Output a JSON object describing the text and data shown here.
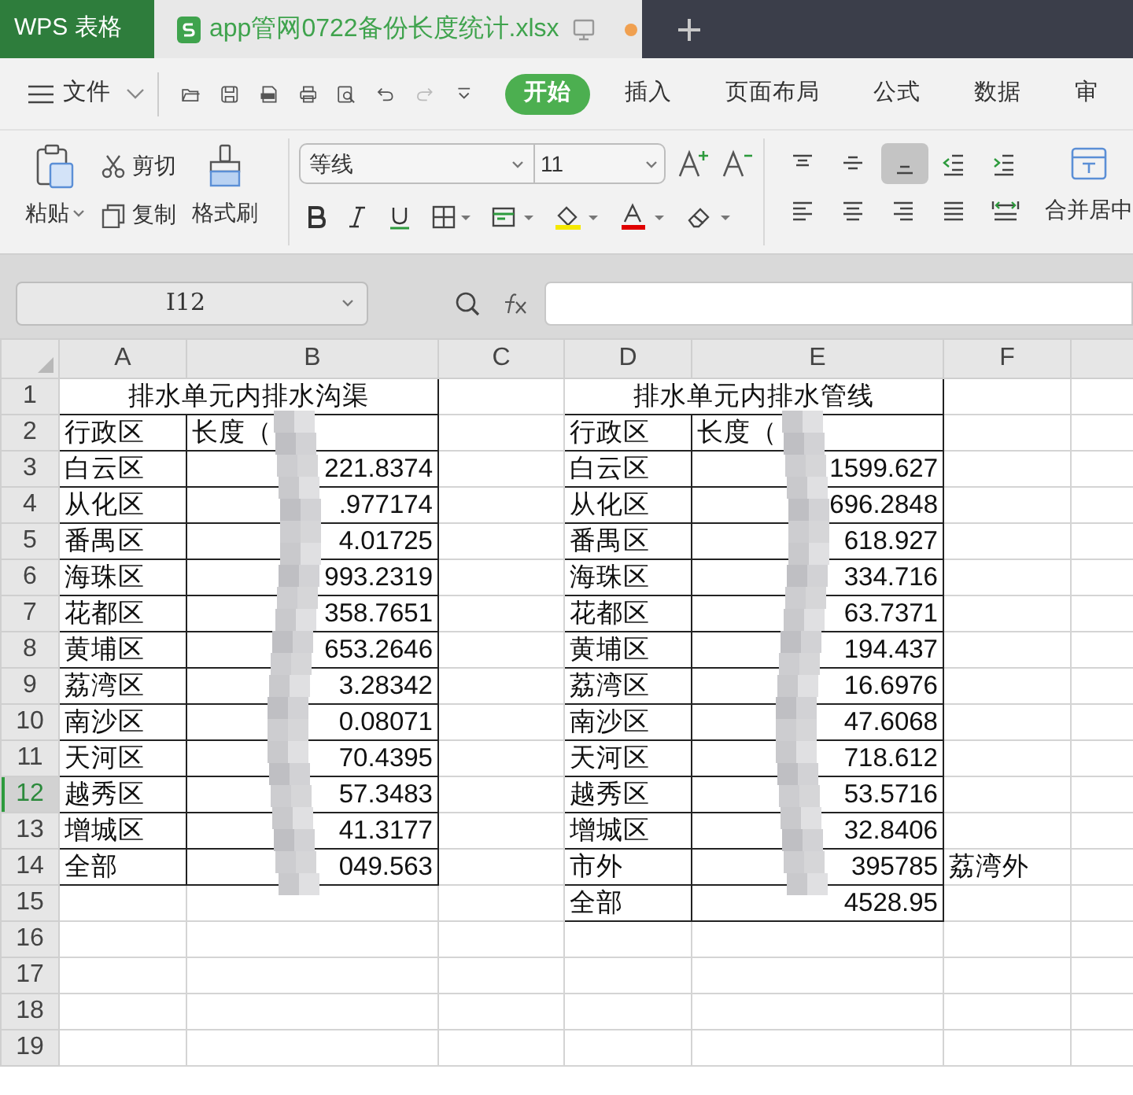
{
  "app_tabs": [
    {
      "kind": "home",
      "label": "WPS 表格",
      "selected": false
    },
    {
      "kind": "document",
      "label": "app管网0722备份长度统计.xlsx",
      "selected": true,
      "unsaved": true
    }
  ],
  "file_menu": "文件",
  "ribbon_tabs": [
    {
      "label": "开始",
      "selected": true
    },
    {
      "label": "插入",
      "selected": false
    },
    {
      "label": "页面布局",
      "selected": false
    },
    {
      "label": "公式",
      "selected": false
    },
    {
      "label": "数据",
      "selected": false
    },
    {
      "label": "审",
      "selected": false
    }
  ],
  "ribbon": {
    "paste": "粘贴",
    "cut": "剪切",
    "copy": "复制",
    "format_painter": "格式刷",
    "font": "等线",
    "font_size": "11",
    "merge": "合并居中",
    "alignment_buttons": [
      {
        "kind": "top",
        "selected": false
      },
      {
        "kind": "middle",
        "selected": false
      },
      {
        "kind": "bottom",
        "selected": true
      },
      {
        "kind": "outdent",
        "selected": false
      },
      {
        "kind": "indent",
        "selected": false
      },
      {
        "kind": "left",
        "selected": false
      },
      {
        "kind": "center",
        "selected": false
      },
      {
        "kind": "right",
        "selected": false
      },
      {
        "kind": "justify",
        "selected": false
      },
      {
        "kind": "distributed",
        "selected": false
      }
    ]
  },
  "name_box": "I12",
  "columns": [
    "A",
    "B",
    "C",
    "D",
    "E",
    "F"
  ],
  "row_headers": [
    {
      "label": "1",
      "selected": false
    },
    {
      "label": "2",
      "selected": false
    },
    {
      "label": "3",
      "selected": false
    },
    {
      "label": "4",
      "selected": false
    },
    {
      "label": "5",
      "selected": false
    },
    {
      "label": "6",
      "selected": false
    },
    {
      "label": "7",
      "selected": false
    },
    {
      "label": "8",
      "selected": false
    },
    {
      "label": "9",
      "selected": false
    },
    {
      "label": "10",
      "selected": false
    },
    {
      "label": "11",
      "selected": false
    },
    {
      "label": "12",
      "selected": true
    },
    {
      "label": "13",
      "selected": false
    },
    {
      "label": "14",
      "selected": false
    },
    {
      "label": "15",
      "selected": false
    },
    {
      "label": "16",
      "selected": false
    },
    {
      "label": "17",
      "selected": false
    },
    {
      "label": "18",
      "selected": false
    },
    {
      "label": "19",
      "selected": false
    }
  ],
  "tables": [
    {
      "title": "排水单元内排水沟渠",
      "header": [
        "行政区",
        "长度（"
      ],
      "rows": [
        [
          "白云区",
          "221.8374"
        ],
        [
          "从化区",
          ".977174"
        ],
        [
          "番禺区",
          "4.01725"
        ],
        [
          "海珠区",
          "993.2319"
        ],
        [
          "花都区",
          "358.7651"
        ],
        [
          "黄埔区",
          "653.2646"
        ],
        [
          "荔湾区",
          "3.28342"
        ],
        [
          "南沙区",
          "0.08071"
        ],
        [
          "天河区",
          "70.4395"
        ],
        [
          "越秀区",
          "57.3483"
        ],
        [
          "增城区",
          "41.3177"
        ],
        [
          "全部",
          "049.563"
        ]
      ]
    },
    {
      "title": "排水单元内排水管线",
      "header": [
        "行政区",
        "长度（"
      ],
      "rows": [
        [
          "白云区",
          "1599.627"
        ],
        [
          "从化区",
          "696.2848"
        ],
        [
          "番禺区",
          "618.927"
        ],
        [
          "海珠区",
          "334.716"
        ],
        [
          "花都区",
          "63.7371"
        ],
        [
          "黄埔区",
          "194.437"
        ],
        [
          "荔湾区",
          "16.6976"
        ],
        [
          "南沙区",
          "47.6068"
        ],
        [
          "天河区",
          "718.612"
        ],
        [
          "越秀区",
          "53.5716"
        ],
        [
          "增城区",
          "32.8406"
        ],
        [
          "市外",
          "395785",
          "荔湾外"
        ],
        [
          "全部",
          "4528.95"
        ]
      ]
    }
  ]
}
